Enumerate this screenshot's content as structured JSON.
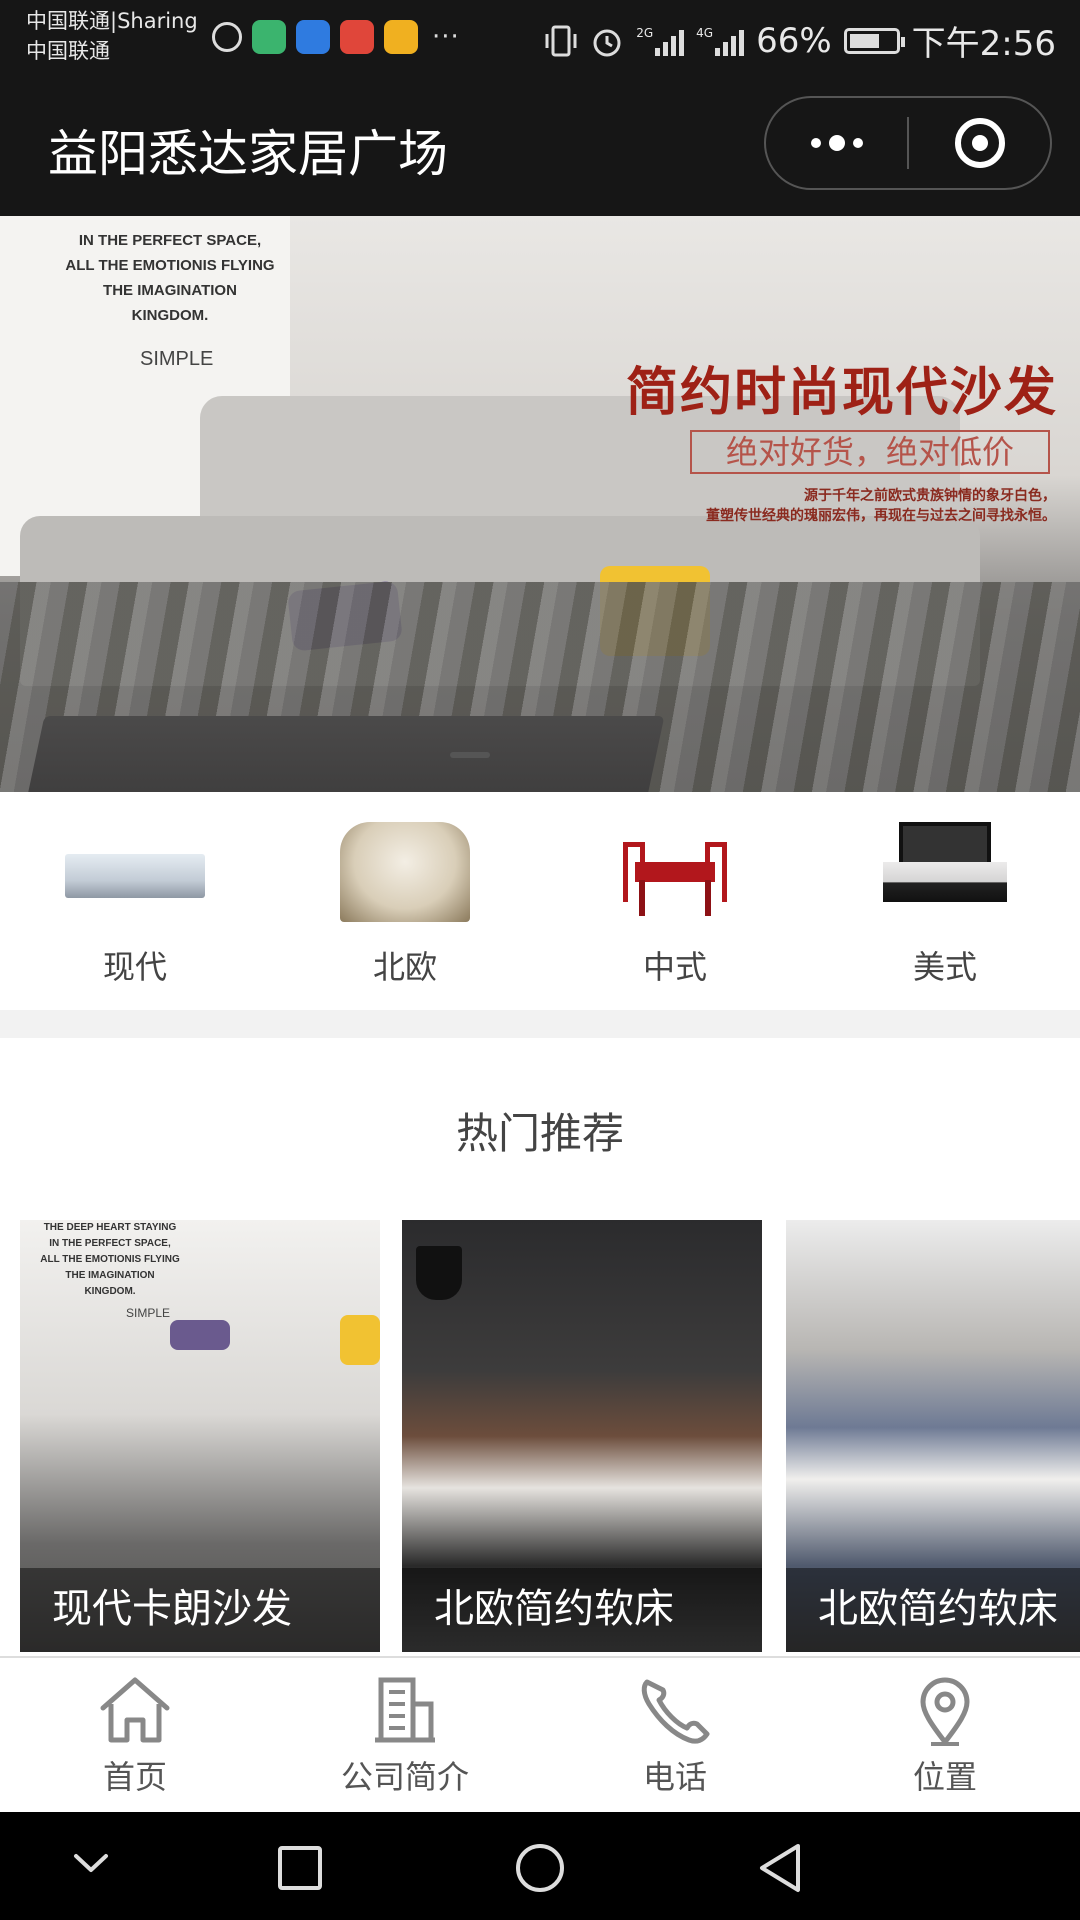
{
  "status_bar": {
    "carrier_line1": "中国联通|Sharing",
    "carrier_line2": "中国联通",
    "network_1": "2G",
    "network_2": "4G",
    "battery": "66%",
    "battery_level": 0.66,
    "time": "下午2:56",
    "overflow": "···"
  },
  "header": {
    "title": "益阳悉达家居广场"
  },
  "banner": {
    "poster_lines": [
      "IN THE PERFECT SPACE,",
      "ALL THE EMOTIONIS FLYING",
      "THE IMAGINATION",
      "KINGDOM."
    ],
    "poster_simple": "SIMPLE",
    "headline": "简约时尚现代沙发",
    "subheadline": "绝对好货，绝对低价",
    "small_copy_1": "源于千年之前欧式贵族钟情的象牙白色，",
    "small_copy_2": "董塑传世经典的瑰丽宏伟，再现在与过去之间寻找永恒。"
  },
  "categories": [
    {
      "label": "现代"
    },
    {
      "label": "北欧"
    },
    {
      "label": "中式"
    },
    {
      "label": "美式"
    }
  ],
  "hot_section": {
    "title": "热门推荐",
    "products": [
      {
        "caption": "现代卡朗沙发",
        "poster_lines": [
          "THE DEEP HEART STAYING",
          "IN THE PERFECT SPACE,",
          "ALL THE EMOTIONIS FLYING",
          "THE IMAGINATION",
          "KINGDOM."
        ],
        "poster_simple": "SIMPLE"
      },
      {
        "caption": "北欧简约软床"
      },
      {
        "caption": "北欧简约软床"
      }
    ]
  },
  "bottom_nav": [
    {
      "label": "首页",
      "icon": "home-icon"
    },
    {
      "label": "公司简介",
      "icon": "building-icon"
    },
    {
      "label": "电话",
      "icon": "phone-icon"
    },
    {
      "label": "位置",
      "icon": "location-pin-icon"
    }
  ]
}
